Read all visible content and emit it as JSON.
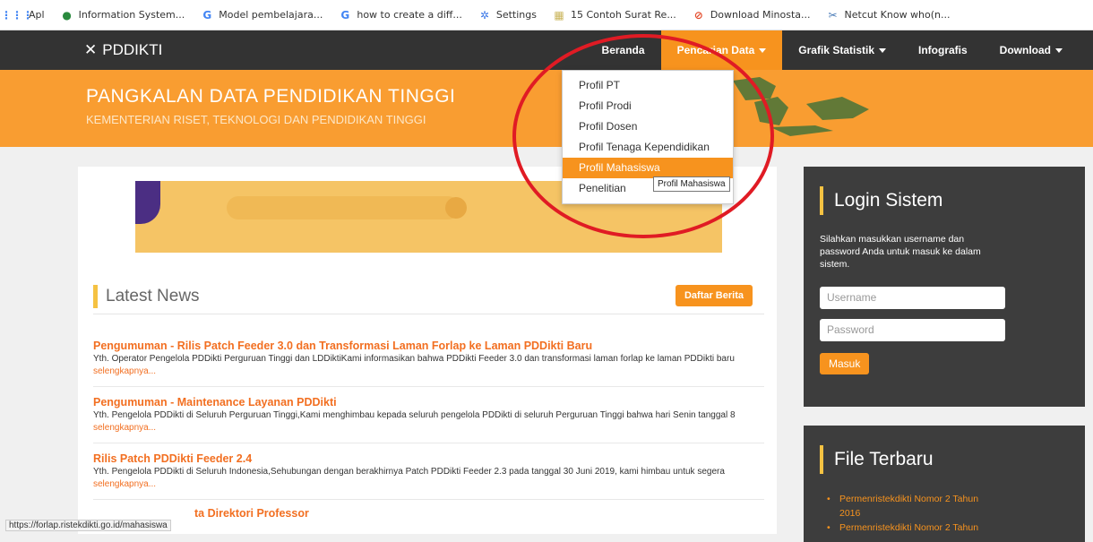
{
  "bookmarks": [
    {
      "label": "Apl",
      "icon": "apps-grid-icon"
    },
    {
      "label": "Information System...",
      "icon": "globe-icon"
    },
    {
      "label": "Model pembelajara...",
      "icon": "google-icon"
    },
    {
      "label": "how to create a diff...",
      "icon": "google-icon"
    },
    {
      "label": "Settings",
      "icon": "gear-icon"
    },
    {
      "label": "15 Contoh Surat Re...",
      "icon": "folder-icon"
    },
    {
      "label": "Download Minosta...",
      "icon": "download-icon"
    },
    {
      "label": "Netcut Know who(n...",
      "icon": "scissors-icon"
    }
  ],
  "brand": "PDDIKTI",
  "nav": {
    "home": "Beranda",
    "search": "Pencarian Data",
    "stats": "Grafik Statistik",
    "info": "Infografis",
    "download": "Download"
  },
  "banner": {
    "title": "PANGKALAN DATA PENDIDIKAN TINGGI",
    "subtitle": "KEMENTERIAN RISET, TEKNOLOGI DAN PENDIDIKAN TINGGI"
  },
  "dropdown": [
    "Profil PT",
    "Profil Prodi",
    "Profil Dosen",
    "Profil Tenaga Kependidikan",
    "Profil Mahasiswa",
    "Penelitian"
  ],
  "tooltip": "Profil Mahasiswa",
  "news": {
    "heading": "Latest News",
    "list_button": "Daftar Berita",
    "more": "selengkapnya...",
    "items": [
      {
        "title": "Pengumuman - Rilis Patch Feeder 3.0 dan Transformasi Laman Forlap ke Laman PDDikti Baru",
        "body": "Yth. Operator Pengelola PDDikti Perguruan Tinggi dan LDDiktiKami informasikan bahwa PDDikti Feeder 3.0 dan transformasi laman forlap ke laman PDDikti baru "
      },
      {
        "title": "Pengumuman - Maintenance Layanan PDDikti",
        "body": "Yth. Pengelola PDDikti di Seluruh Perguruan Tinggi,Kami menghimbau kepada seluruh pengelola PDDikti di seluruh Perguruan Tinggi bahwa hari Senin tanggal 8 "
      },
      {
        "title": "Rilis Patch PDDikti Feeder 2.4",
        "body": "Yth. Pengelola PDDikti di Seluruh Indonesia,Sehubungan dengan berakhirnya Patch PDDikti Feeder 2.3 pada tanggal 30 Juni 2019, kami himbau untuk segera "
      },
      {
        "title": "ta Direktori Professor",
        "body": ""
      }
    ]
  },
  "login": {
    "heading": "Login Sistem",
    "desc": "Silahkan masukkan username dan password Anda untuk masuk ke dalam sistem.",
    "username_ph": "Username",
    "password_ph": "Password",
    "submit": "Masuk"
  },
  "files": {
    "heading": "File Terbaru",
    "items": [
      "Permenristekdikti Nomor 2 Tahun 2016",
      "Permenristekdikti Nomor 2 Tahun"
    ]
  },
  "status_url": "https://forlap.ristekdikti.go.id/mahasiswa",
  "colors": {
    "accent": "#f7931e",
    "dark": "#333333",
    "highlight": "#e01b24"
  }
}
